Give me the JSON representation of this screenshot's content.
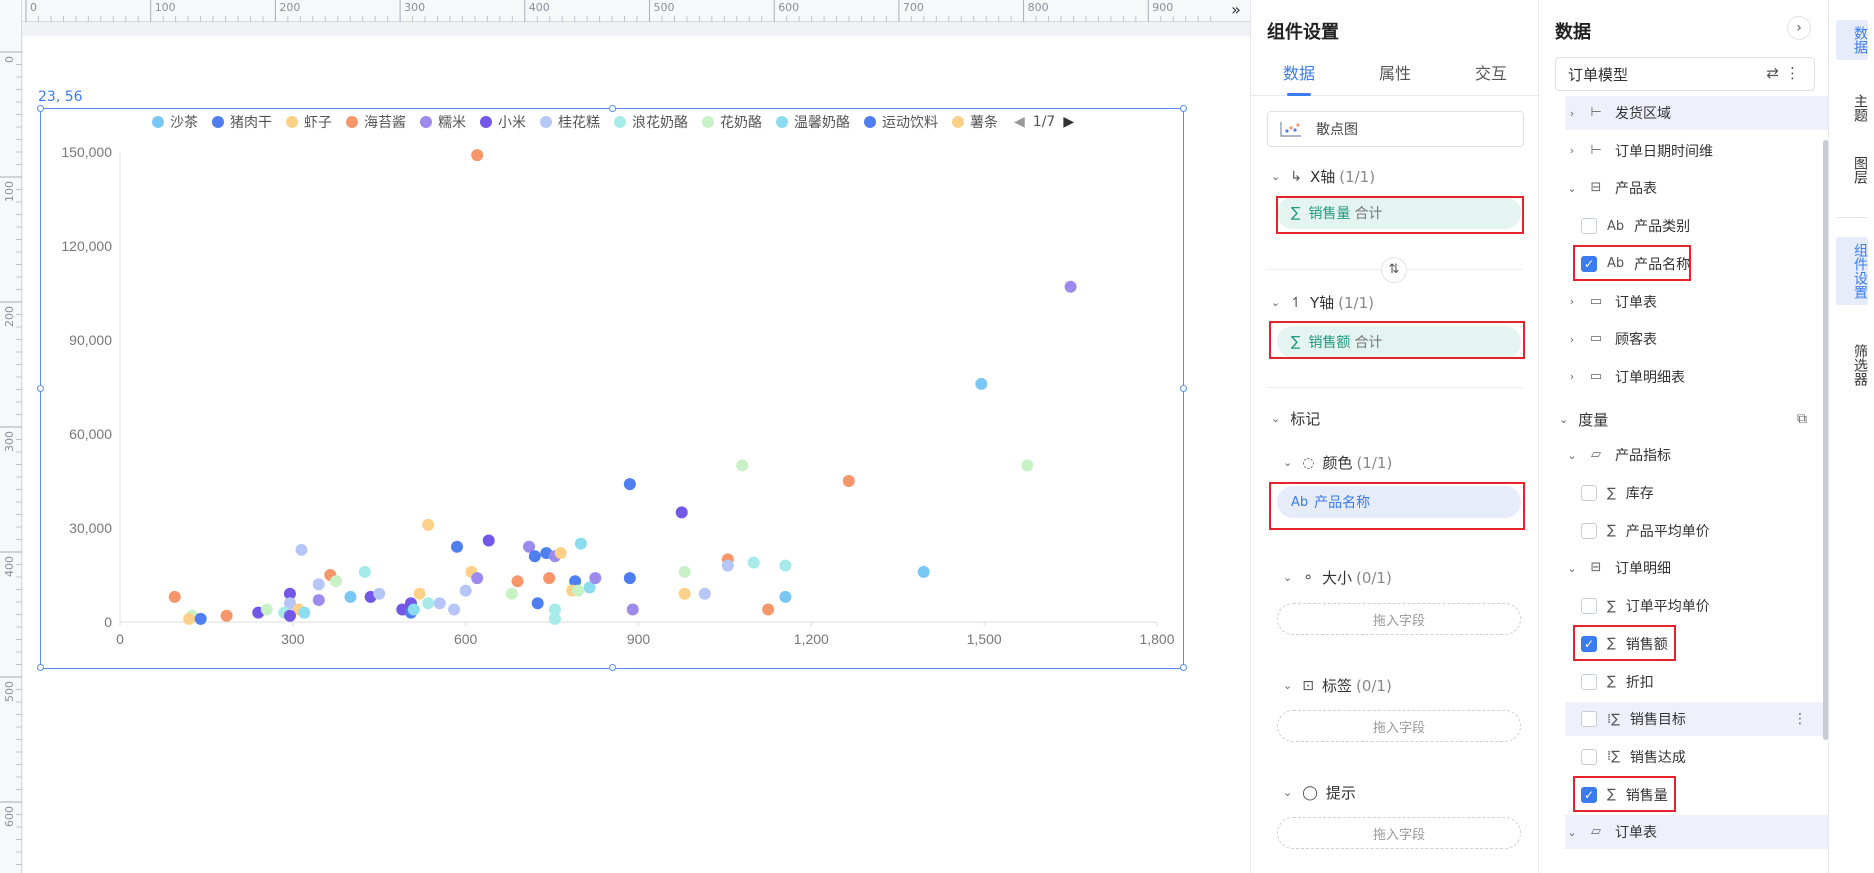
{
  "canvas": {
    "coord_label": "23, 56",
    "ruler_top_labels": [
      "0",
      "100",
      "200",
      "300",
      "400",
      "500",
      "600",
      "700",
      "800",
      "900"
    ],
    "ruler_left_labels": [
      "0",
      "100",
      "200",
      "300",
      "400",
      "500",
      "600"
    ]
  },
  "chart_data": {
    "type": "scatter",
    "title": "",
    "xlabel": "",
    "ylabel": "",
    "xlim": [
      0,
      1800
    ],
    "ylim": [
      0,
      150000
    ],
    "x_ticks": [
      "0",
      "300",
      "600",
      "900",
      "1,200",
      "1,500",
      "1,800"
    ],
    "y_ticks": [
      "0",
      "30,000",
      "60,000",
      "90,000",
      "120,000",
      "150,000"
    ],
    "legend": {
      "page": "1/7",
      "items": [
        {
          "name": "沙茶",
          "color": "#79c7f5"
        },
        {
          "name": "猪肉干",
          "color": "#4f7ef0"
        },
        {
          "name": "虾子",
          "color": "#fdd08a"
        },
        {
          "name": "海苔酱",
          "color": "#f7966b"
        },
        {
          "name": "糯米",
          "color": "#9d8aef"
        },
        {
          "name": "小米",
          "color": "#7257e8"
        },
        {
          "name": "桂花糕",
          "color": "#b7c6f8"
        },
        {
          "name": "浪花奶酪",
          "color": "#a7eaea"
        },
        {
          "name": "花奶酪",
          "color": "#c8f1c6"
        },
        {
          "name": "温馨奶酪",
          "color": "#8cdcf0"
        },
        {
          "name": "运动饮料",
          "color": "#4f7ef0"
        },
        {
          "name": "薯条",
          "color": "#fdd08a"
        }
      ]
    },
    "points": [
      {
        "x": 620,
        "y": 149000,
        "c": "#f7966b"
      },
      {
        "x": 1650,
        "y": 107000,
        "c": "#9d8aef"
      },
      {
        "x": 1495,
        "y": 76000,
        "c": "#79c7f5"
      },
      {
        "x": 1575,
        "y": 50000,
        "c": "#c8f1c6"
      },
      {
        "x": 1080,
        "y": 50000,
        "c": "#c8f1c6"
      },
      {
        "x": 1265,
        "y": 45000,
        "c": "#f7966b"
      },
      {
        "x": 885,
        "y": 44000,
        "c": "#4f7ef0"
      },
      {
        "x": 975,
        "y": 35000,
        "c": "#7257e8"
      },
      {
        "x": 535,
        "y": 31000,
        "c": "#fdd08a"
      },
      {
        "x": 640,
        "y": 26000,
        "c": "#7257e8"
      },
      {
        "x": 585,
        "y": 24000,
        "c": "#4f7ef0"
      },
      {
        "x": 800,
        "y": 25000,
        "c": "#8cdcf0"
      },
      {
        "x": 315,
        "y": 23000,
        "c": "#b7c6f8"
      },
      {
        "x": 710,
        "y": 24000,
        "c": "#9d8aef"
      },
      {
        "x": 720,
        "y": 21000,
        "c": "#4f7ef0"
      },
      {
        "x": 740,
        "y": 22000,
        "c": "#4f7ef0"
      },
      {
        "x": 755,
        "y": 21000,
        "c": "#9d8aef"
      },
      {
        "x": 765,
        "y": 22000,
        "c": "#fdd08a"
      },
      {
        "x": 1055,
        "y": 20000,
        "c": "#f7966b"
      },
      {
        "x": 1100,
        "y": 19000,
        "c": "#a7eaea"
      },
      {
        "x": 1155,
        "y": 18000,
        "c": "#a7eaea"
      },
      {
        "x": 1055,
        "y": 18000,
        "c": "#b7c6f8"
      },
      {
        "x": 980,
        "y": 16000,
        "c": "#c8f1c6"
      },
      {
        "x": 1395,
        "y": 16000,
        "c": "#79c7f5"
      },
      {
        "x": 425,
        "y": 16000,
        "c": "#a7eaea"
      },
      {
        "x": 365,
        "y": 15000,
        "c": "#f7966b"
      },
      {
        "x": 375,
        "y": 13000,
        "c": "#c8f1c6"
      },
      {
        "x": 345,
        "y": 12000,
        "c": "#b7c6f8"
      },
      {
        "x": 610,
        "y": 16000,
        "c": "#fdd08a"
      },
      {
        "x": 620,
        "y": 14000,
        "c": "#9d8aef"
      },
      {
        "x": 600,
        "y": 10000,
        "c": "#b7c6f8"
      },
      {
        "x": 690,
        "y": 13000,
        "c": "#f7966b"
      },
      {
        "x": 745,
        "y": 14000,
        "c": "#f7966b"
      },
      {
        "x": 790,
        "y": 13000,
        "c": "#4f7ef0"
      },
      {
        "x": 815,
        "y": 11000,
        "c": "#8cdcf0"
      },
      {
        "x": 825,
        "y": 14000,
        "c": "#9d8aef"
      },
      {
        "x": 885,
        "y": 14000,
        "c": "#4f7ef0"
      },
      {
        "x": 785,
        "y": 10000,
        "c": "#fdd08a"
      },
      {
        "x": 795,
        "y": 10000,
        "c": "#c8f1c6"
      },
      {
        "x": 680,
        "y": 9000,
        "c": "#c8f1c6"
      },
      {
        "x": 980,
        "y": 9000,
        "c": "#fdd08a"
      },
      {
        "x": 1015,
        "y": 9000,
        "c": "#b7c6f8"
      },
      {
        "x": 1155,
        "y": 8000,
        "c": "#79c7f5"
      },
      {
        "x": 95,
        "y": 8000,
        "c": "#f7966b"
      },
      {
        "x": 295,
        "y": 9000,
        "c": "#7257e8"
      },
      {
        "x": 400,
        "y": 8000,
        "c": "#79c7f5"
      },
      {
        "x": 435,
        "y": 8000,
        "c": "#7257e8"
      },
      {
        "x": 450,
        "y": 9000,
        "c": "#b7c6f8"
      },
      {
        "x": 520,
        "y": 9000,
        "c": "#fdd08a"
      },
      {
        "x": 345,
        "y": 7000,
        "c": "#9d8aef"
      },
      {
        "x": 295,
        "y": 6000,
        "c": "#b7c6f8"
      },
      {
        "x": 535,
        "y": 6000,
        "c": "#a7eaea"
      },
      {
        "x": 555,
        "y": 6000,
        "c": "#b7c6f8"
      },
      {
        "x": 505,
        "y": 6000,
        "c": "#7257e8"
      },
      {
        "x": 725,
        "y": 6000,
        "c": "#4f7ef0"
      },
      {
        "x": 755,
        "y": 4000,
        "c": "#a7eaea"
      },
      {
        "x": 890,
        "y": 4000,
        "c": "#9d8aef"
      },
      {
        "x": 1125,
        "y": 4000,
        "c": "#f7966b"
      },
      {
        "x": 580,
        "y": 4000,
        "c": "#b7c6f8"
      },
      {
        "x": 490,
        "y": 4000,
        "c": "#7257e8"
      },
      {
        "x": 505,
        "y": 3000,
        "c": "#4f7ef0"
      },
      {
        "x": 510,
        "y": 4000,
        "c": "#8cdcf0"
      },
      {
        "x": 240,
        "y": 3000,
        "c": "#7257e8"
      },
      {
        "x": 255,
        "y": 4000,
        "c": "#c8f1c6"
      },
      {
        "x": 285,
        "y": 3000,
        "c": "#a7eaea"
      },
      {
        "x": 310,
        "y": 4000,
        "c": "#fdd08a"
      },
      {
        "x": 320,
        "y": 3000,
        "c": "#8cdcf0"
      },
      {
        "x": 295,
        "y": 2000,
        "c": "#7257e8"
      },
      {
        "x": 125,
        "y": 2000,
        "c": "#c8f1c6"
      },
      {
        "x": 120,
        "y": 1000,
        "c": "#fdd08a"
      },
      {
        "x": 140,
        "y": 1000,
        "c": "#4f7ef0"
      },
      {
        "x": 185,
        "y": 2000,
        "c": "#f7966b"
      },
      {
        "x": 755,
        "y": 1000,
        "c": "#a7eaea"
      }
    ]
  },
  "settings": {
    "title": "组件设置",
    "tabs": [
      "数据",
      "属性",
      "交互"
    ],
    "chart_type": "散点图",
    "x_axis": {
      "label": "X轴",
      "count": "(1/1)",
      "field": "销售量",
      "agg": "合计"
    },
    "y_axis": {
      "label": "Y轴",
      "count": "(1/1)",
      "field": "销售额",
      "agg": "合计"
    },
    "marks": {
      "label": "标记"
    },
    "color": {
      "label": "颜色",
      "count": "(1/1)",
      "field": "产品名称"
    },
    "size": {
      "label": "大小",
      "count": "(0/1)",
      "placeholder": "拖入字段"
    },
    "tag": {
      "label": "标签",
      "count": "(0/1)",
      "placeholder": "拖入字段"
    },
    "tooltip": {
      "label": "提示",
      "placeholder": "拖入字段"
    }
  },
  "data_panel": {
    "title": "数据",
    "model": "订单模型",
    "dimension_rows": [
      {
        "label": "发货区域",
        "kind": "hier",
        "expanded": false,
        "indent": 0
      },
      {
        "label": "订单日期时间维",
        "kind": "hier",
        "expanded": false,
        "indent": 0
      },
      {
        "label": "产品表",
        "kind": "table-check",
        "expanded": true,
        "indent": 0
      },
      {
        "label": "产品类别",
        "kind": "text",
        "checked": false,
        "indent": 1
      },
      {
        "label": "产品名称",
        "kind": "text",
        "checked": true,
        "indent": 1
      },
      {
        "label": "订单表",
        "kind": "folder",
        "expanded": false,
        "indent": 0
      },
      {
        "label": "顾客表",
        "kind": "folder",
        "expanded": false,
        "indent": 0
      },
      {
        "label": "订单明细表",
        "kind": "folder",
        "expanded": false,
        "indent": 0
      }
    ],
    "measure_title": "度量",
    "measure_rows": [
      {
        "label": "产品指标",
        "kind": "folder-open",
        "expanded": true,
        "indent": 0
      },
      {
        "label": "库存",
        "kind": "sum",
        "checked": false,
        "indent": 1
      },
      {
        "label": "产品平均单价",
        "kind": "sum",
        "checked": false,
        "indent": 1
      },
      {
        "label": "订单明细",
        "kind": "table-check",
        "expanded": true,
        "indent": 0
      },
      {
        "label": "订单平均单价",
        "kind": "sum",
        "checked": false,
        "indent": 1
      },
      {
        "label": "销售额",
        "kind": "sum",
        "checked": true,
        "indent": 1
      },
      {
        "label": "折扣",
        "kind": "sum",
        "checked": false,
        "indent": 1
      },
      {
        "label": "销售目标",
        "kind": "calc",
        "checked": false,
        "indent": 1
      },
      {
        "label": "销售达成",
        "kind": "calc",
        "checked": false,
        "indent": 1
      },
      {
        "label": "销售量",
        "kind": "sum",
        "checked": true,
        "indent": 1
      },
      {
        "label": "订单表",
        "kind": "folder-open",
        "expanded": true,
        "indent": 0
      }
    ]
  },
  "rail": {
    "items": [
      "数据",
      "主题",
      "图层",
      "组件设置",
      "筛选器"
    ]
  }
}
